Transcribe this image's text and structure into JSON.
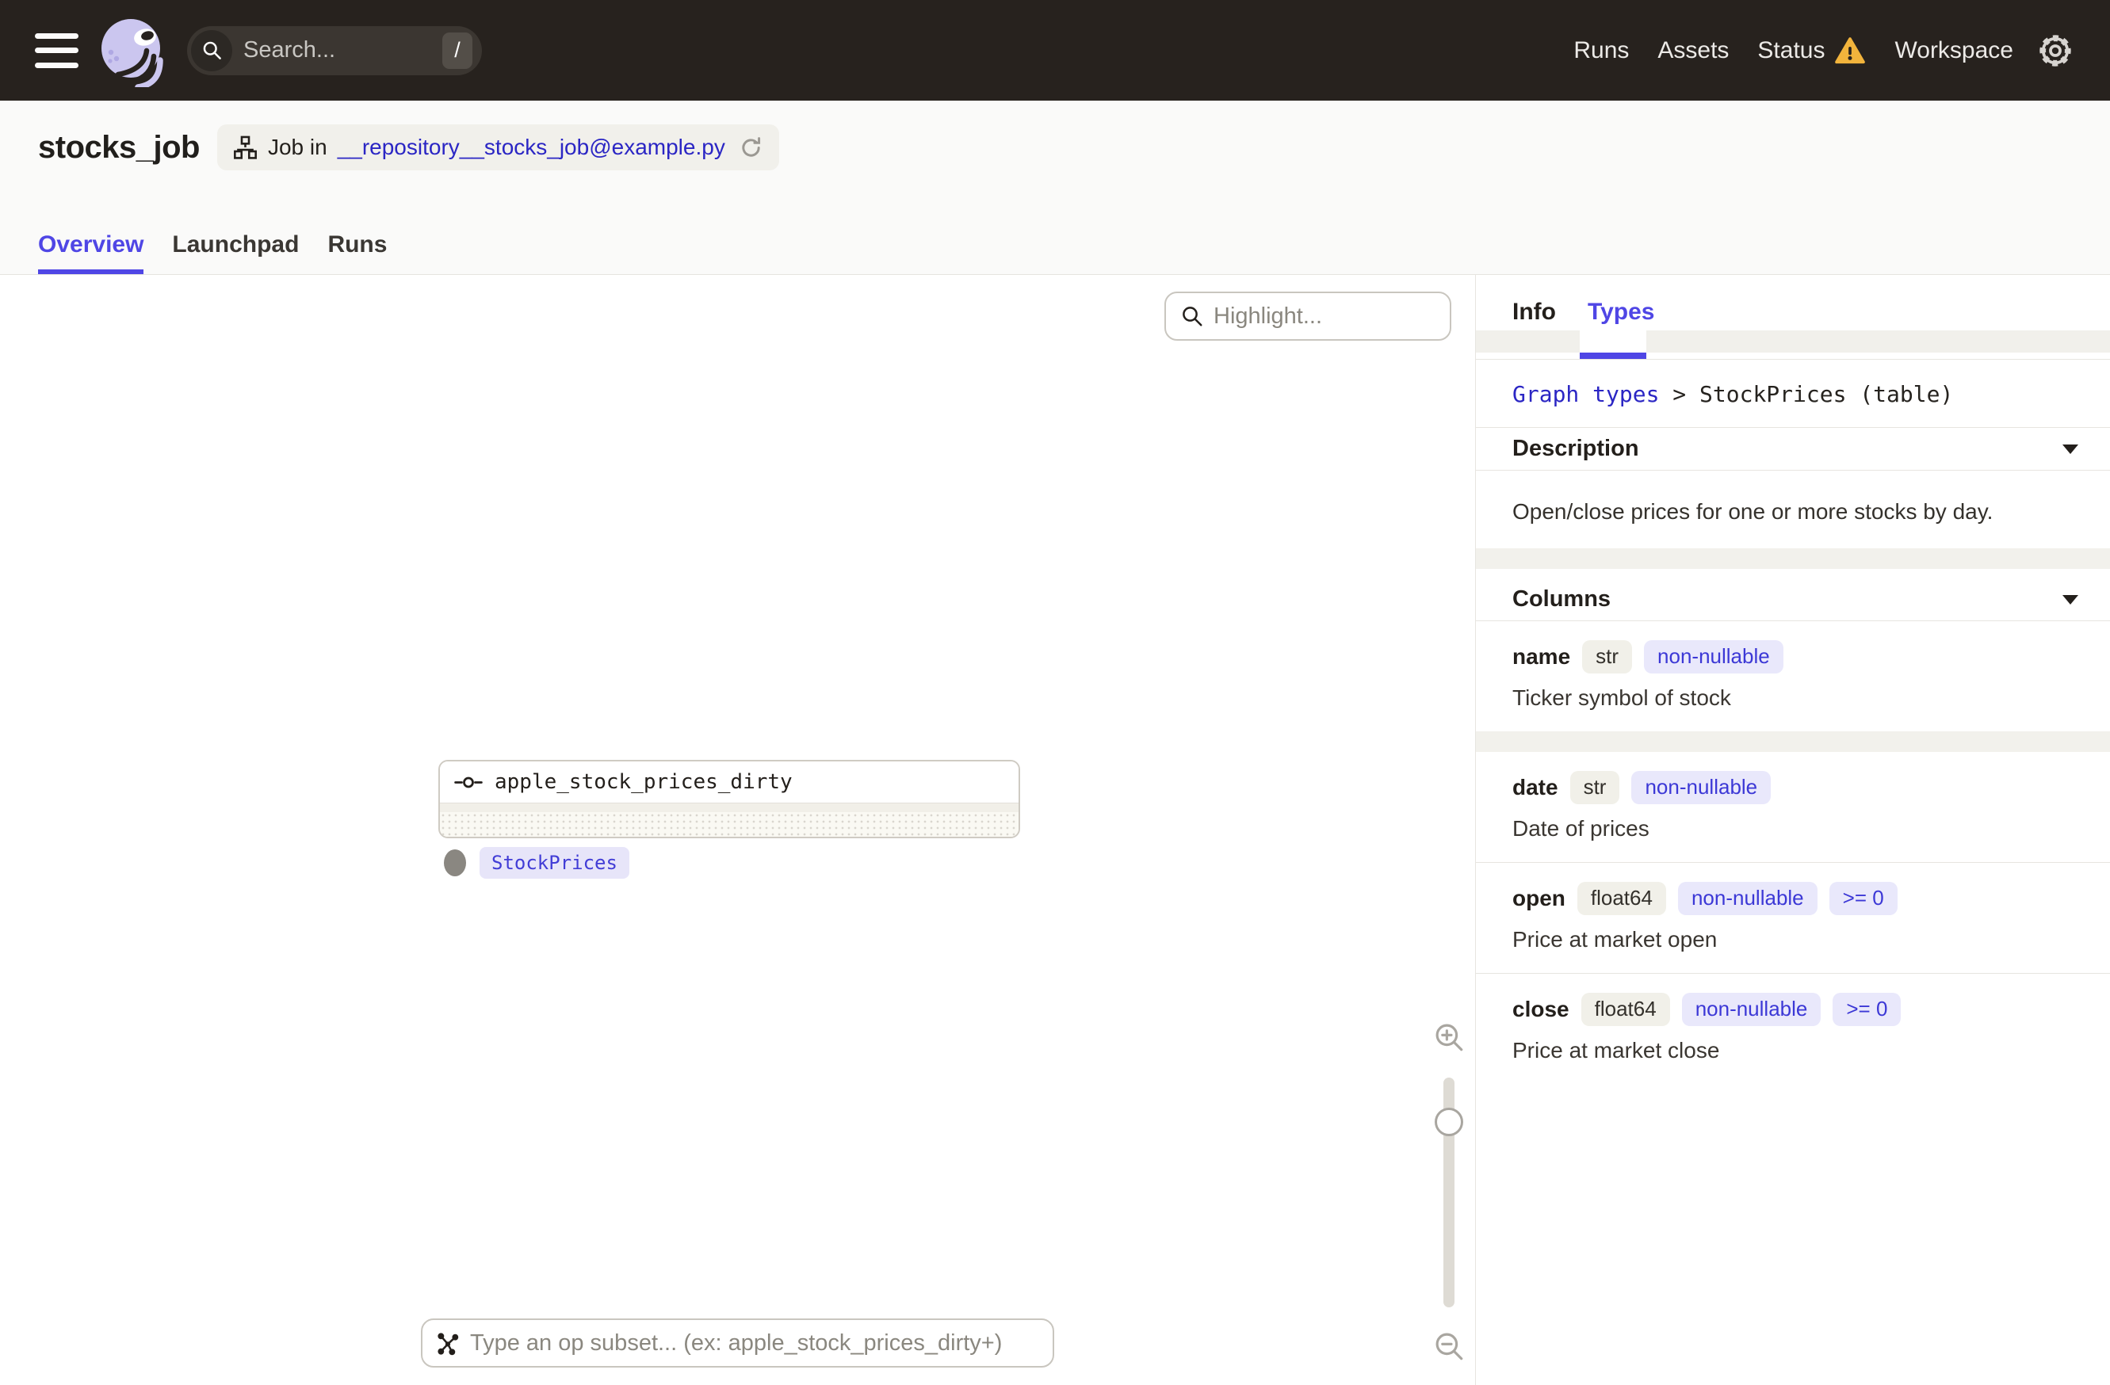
{
  "navbar": {
    "search_placeholder": "Search...",
    "search_shortcut": "/",
    "links": [
      {
        "label": "Runs"
      },
      {
        "label": "Assets"
      },
      {
        "label": "Status"
      },
      {
        "label": "Workspace"
      }
    ]
  },
  "header": {
    "title": "stocks_job",
    "job_pill": {
      "prefix": "Job in",
      "link": "__repository__stocks_job@example.py"
    },
    "tabs": [
      {
        "label": "Overview"
      },
      {
        "label": "Launchpad"
      },
      {
        "label": "Runs"
      }
    ]
  },
  "canvas": {
    "highlight_placeholder": "Highlight...",
    "node": {
      "label": "apple_stock_prices_dirty",
      "output_type": "StockPrices"
    },
    "subset_placeholder": "Type an op subset... (ex: apple_stock_prices_dirty+)"
  },
  "sidepanel": {
    "tabs": [
      {
        "label": "Info"
      },
      {
        "label": "Types"
      }
    ],
    "breadcrumb": {
      "link": "Graph types",
      "rest": " > StockPrices (table)"
    },
    "description_section": {
      "title": "Description",
      "content": "Open/close prices for one or more stocks by day."
    },
    "columns_section": {
      "title": "Columns"
    },
    "columns": [
      {
        "name": "name",
        "type": "str",
        "badges": [
          "non-nullable"
        ],
        "description": "Ticker symbol of stock"
      },
      {
        "name": "date",
        "type": "str",
        "badges": [
          "non-nullable"
        ],
        "description": "Date of prices"
      },
      {
        "name": "open",
        "type": "float64",
        "badges": [
          "non-nullable",
          ">= 0"
        ],
        "description": "Price at market open"
      },
      {
        "name": "close",
        "type": "float64",
        "badges": [
          "non-nullable",
          ">= 0"
        ],
        "description": "Price at market close"
      }
    ]
  },
  "colors": {
    "accent": "#4F46E5",
    "mono_link": "#2B26C4",
    "warning": "#F2B43C",
    "navbar_bg": "#27221E",
    "badge_constraint_bg": "#E9E8FB",
    "badge_type_bg": "#F1F0E9"
  }
}
